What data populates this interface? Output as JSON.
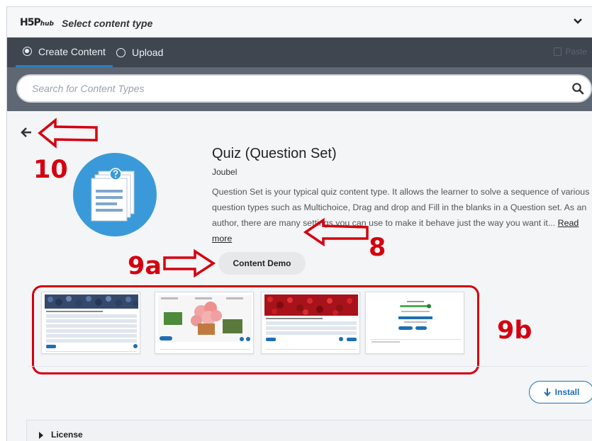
{
  "header": {
    "logo": "H5P",
    "logo_sub": "hub",
    "title": "Select content type"
  },
  "tabs": [
    {
      "label": "Create Content",
      "selected": true
    },
    {
      "label": "Upload",
      "selected": false
    }
  ],
  "paste_label": "Paste",
  "search": {
    "placeholder": "Search for Content Types",
    "value": ""
  },
  "content_type": {
    "title": "Quiz (Question Set)",
    "owner": "Joubel",
    "description": "Question Set is your typical quiz content type. It allows the learner to solve a sequence of various question types such as Multichoice, Drag and drop and Fill in the blanks in a Question set. As an author, there are many settings you can use to make it behave just the way you want it...",
    "read_more": "Read more",
    "demo_label": "Content Demo",
    "install_label": "Install",
    "screenshot_count": 4
  },
  "license_label": "License",
  "annotations": {
    "back": "10",
    "read_more": "8",
    "demo": "9a",
    "screenshots": "9b"
  },
  "colors": {
    "tabbar": "#3f4650",
    "search_band": "#5e6773",
    "accent_blue": "#1f6fb2",
    "icon_blue": "#3a9ad9",
    "annotation_red": "#d4000f"
  }
}
